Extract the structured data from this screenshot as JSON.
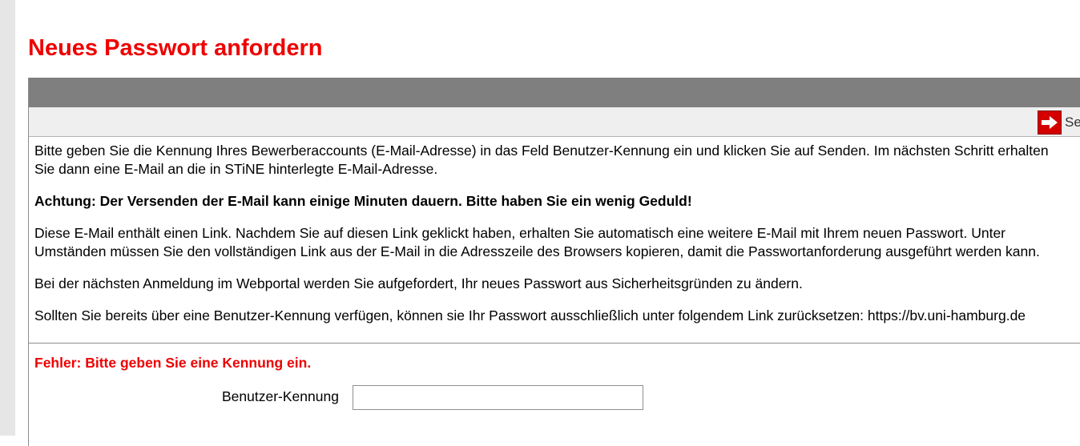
{
  "page": {
    "title": "Neues Passwort anfordern"
  },
  "toolbar": {
    "send_label": "Senden",
    "send_icon": "arrow-right-icon"
  },
  "info": {
    "line1": "Bitte geben Sie die Kennung Ihres Bewerberaccounts (E-Mail-Adresse) in das Feld Benutzer-Kennung ein und klicken Sie auf Senden. Im nächsten Schritt erhalten",
    "line2": "Sie dann eine E-Mail an die in STiNE hinterlegte E-Mail-Adresse.",
    "warning": "Achtung: Der Versenden der E-Mail kann einige Minuten dauern. Bitte haben Sie ein wenig Geduld!",
    "link_line1": "Diese E-Mail enthält einen Link. Nachdem Sie auf diesen Link geklickt haben, erhalten Sie automatisch eine weitere E-Mail mit Ihrem neuen Passwort. Unter",
    "link_line2": "Umständen müssen Sie den vollständigen Link aus der E-Mail in die Adresszeile des Browsers kopieren, damit die Passwortanforderung ausgeführt werden kann.",
    "change_notice": "Bei der nächsten Anmeldung im Webportal werden Sie aufgefordert, Ihr neues Passwort aus Sicherheitsgründen zu ändern.",
    "existing_account": "Sollten Sie bereits über eine Benutzer-Kennung verfügen, können sie Ihr Passwort ausschließlich unter folgendem Link zurücksetzen: https://bv.uni-hamburg.de"
  },
  "form": {
    "error": "Fehler: Bitte geben Sie eine Kennung ein.",
    "username_label": "Benutzer-Kennung",
    "username_value": ""
  },
  "colors": {
    "title": "#ee0000",
    "header_bar": "#7f7f7f",
    "toolbar_bg": "#efefef",
    "send_icon_bg": "#d40000",
    "error": "#ee0000"
  }
}
